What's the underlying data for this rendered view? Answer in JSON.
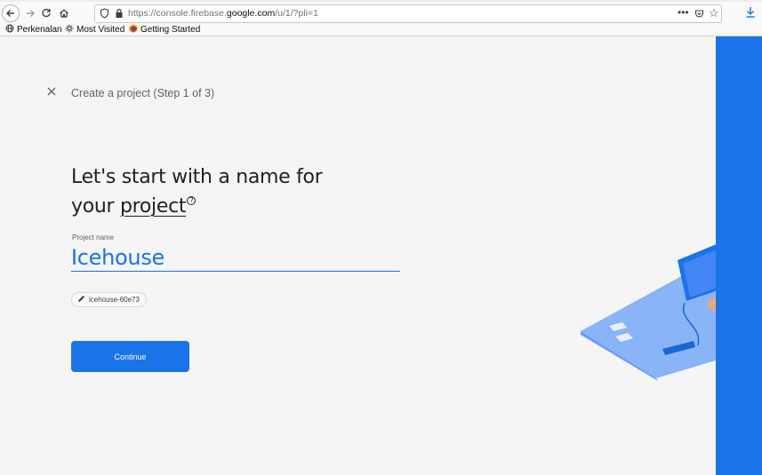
{
  "browser": {
    "url_prefix": "https://console.firebase.",
    "url_domain": "google.com",
    "url_suffix": "/u/1/?pli=1",
    "url_menu": "•••"
  },
  "bookmarks": [
    {
      "label": "Perkenalan",
      "icon": "globe-icon"
    },
    {
      "label": "Most Visited",
      "icon": "gear-icon"
    },
    {
      "label": "Getting Started",
      "icon": "firefox-icon"
    }
  ],
  "wizard": {
    "step_title": "Create a project (Step 1 of 3)",
    "headline_line1": "Let's start with a name for",
    "headline_line2_prefix": "your ",
    "headline_link": "project",
    "field_label": "Project name",
    "field_value": "Icehouse",
    "project_id": "icehouse-60e73",
    "continue_label": "Continue"
  },
  "colors": {
    "accent": "#1a73e8",
    "background": "#f5f5f5"
  }
}
